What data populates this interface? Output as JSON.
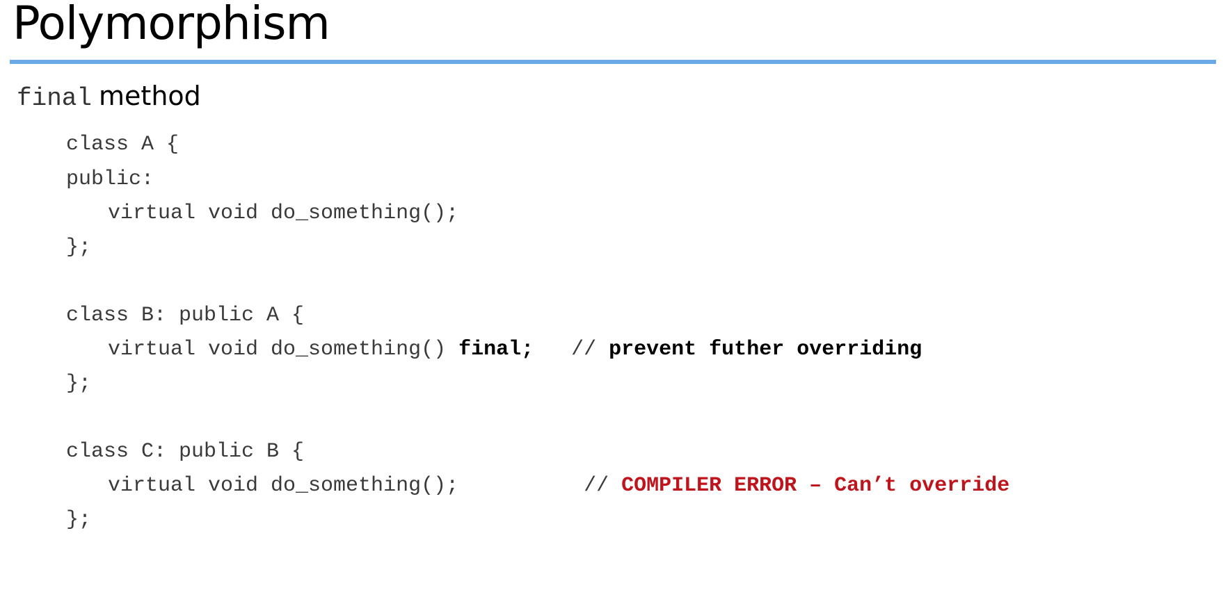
{
  "slide": {
    "title": "Polymorphism",
    "subtitle_keyword": "final",
    "subtitle_text": "method"
  },
  "code": {
    "l1": "class A {",
    "l2": "public:",
    "l3": "virtual void do_something();",
    "l4": "};",
    "l5": "class B: public A {",
    "l6_code": "virtual void do_something() ",
    "l6_kw": "final;",
    "l6_sep": "   // ",
    "l6_comment": "prevent futher overriding",
    "l7": "};",
    "l8": "class C: public B {",
    "l9_code": "virtual void do_something();          // ",
    "l9_comment": "COMPILER ERROR – Can’t override",
    "l10": "};"
  },
  "colors": {
    "rule": "#6aa8e6",
    "error": "#c0141c"
  }
}
